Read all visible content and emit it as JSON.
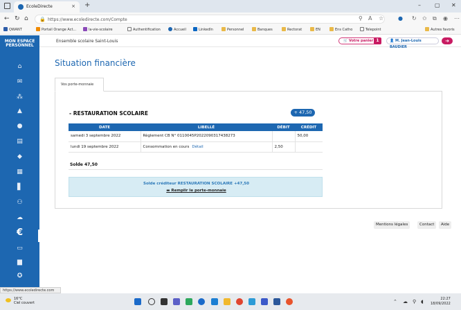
{
  "browser": {
    "tab_title": "EcoleDirecte",
    "url": "https://www.ecoledirecte.com/Compte",
    "bookmarks": [
      "QWANT",
      "Portail Orange Act...",
      "la-vie-scolaire",
      "Authentification",
      "Accueil",
      "LinkedIn",
      "Personnel",
      "Banques",
      "Rectorat",
      "EN",
      "Ens Catho",
      "Telepoint",
      "Autres favoris"
    ],
    "status_url": "https://www.ecoledirecte.com"
  },
  "sidebar": {
    "title_line1": "MON ESPACE",
    "title_line2": "PERSONNEL",
    "items": [
      {
        "icon": "home-icon",
        "glyph": "⌂"
      },
      {
        "icon": "mail-icon",
        "glyph": "✉"
      },
      {
        "icon": "group-icon",
        "glyph": "⁂"
      },
      {
        "icon": "graduation-icon",
        "glyph": "▲"
      },
      {
        "icon": "circle-icon",
        "glyph": "●"
      },
      {
        "icon": "document-icon",
        "glyph": "▤"
      },
      {
        "icon": "layers-icon",
        "glyph": "◆"
      },
      {
        "icon": "calendar-icon",
        "glyph": "▦"
      },
      {
        "icon": "notebook-icon",
        "glyph": "▋"
      },
      {
        "icon": "network-icon",
        "glyph": "⚇"
      },
      {
        "icon": "cloud-icon",
        "glyph": "☁"
      },
      {
        "icon": "euro-icon",
        "glyph": "€"
      },
      {
        "icon": "card-icon",
        "glyph": "▭"
      },
      {
        "icon": "book-icon",
        "glyph": "▆"
      },
      {
        "icon": "help-icon",
        "glyph": "✪"
      }
    ]
  },
  "header": {
    "school": "Ensemble scolaire Saint-Louis",
    "cart_label": "Votre panier",
    "cart_count": "1",
    "user_name": "M. Jean-Louis BAUDIER"
  },
  "main": {
    "title": "Situation financière",
    "tab_label": "Vos porte-monnaie",
    "section_title": "- RESTAURATION SCOLAIRE",
    "section_amount": "+ 47,50",
    "columns": [
      "DATE",
      "LIBELLÉ",
      "DÉBIT",
      "CRÉDIT"
    ],
    "rows": [
      {
        "date": "samedi 3 septembre 2022",
        "libelle": "Règlement CB N° 0110045P2022090317438273",
        "detail": "",
        "debit": "",
        "credit": "50,00"
      },
      {
        "date": "lundi 19 septembre 2022",
        "libelle": "Consommation en cours",
        "detail": "Détail",
        "debit": "2,50",
        "credit": ""
      }
    ],
    "solde": "Solde 47,50",
    "info_text": "Solde créditeur RESTAURATION SCOLAIRE +47,50",
    "refill_label": "Remplir le porte-monnaie"
  },
  "footer": {
    "legal": "Mentions légales",
    "contact": "Contact",
    "help": "Aide"
  },
  "taskbar": {
    "temp": "16°C",
    "weather": "Ciel couvert",
    "time": "22:27",
    "date": "18/09/2022"
  }
}
